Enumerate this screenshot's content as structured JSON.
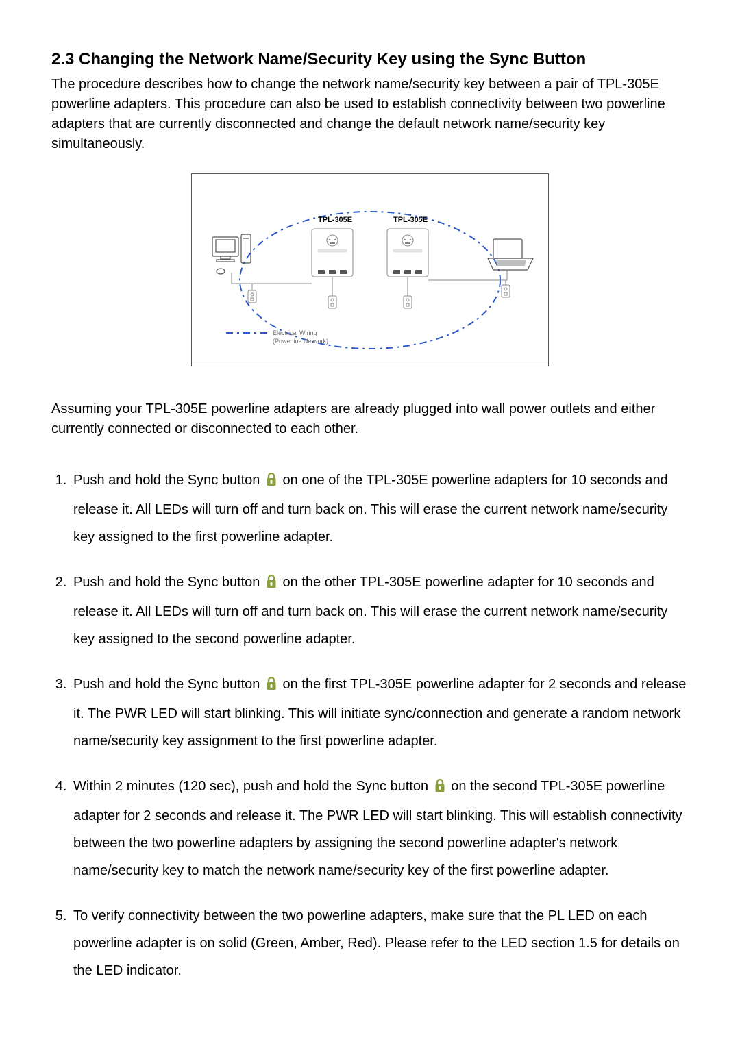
{
  "heading": "2.3  Changing the Network Name/Security Key using the Sync Button",
  "intro": "The procedure describes how to change the network name/security key between a pair of TPL-305E powerline adapters. This procedure can also be used to establish connectivity between two powerline adapters that are currently disconnected and change the default network name/security key simultaneously.",
  "assume": "Assuming your TPL-305E powerline adapters are already plugged into wall power outlets and either currently connected or disconnected to each other.",
  "diagram": {
    "device_a": "TPL-305E",
    "device_b": "TPL-305E",
    "legend_a": "Electrical Wiring",
    "legend_b": "(Powerline Network)"
  },
  "steps": {
    "s1a": "Push and hold the Sync button ",
    "s1b": " on one of the TPL-305E powerline adapters for 10 seconds and release it. All LEDs will turn off and turn back on. This will erase the current network name/security key assigned to the first powerline adapter.",
    "s2a": "Push and hold the Sync button ",
    "s2b": " on the other TPL-305E powerline adapter for 10 seconds and release it. All LEDs will turn off and turn back on. This will erase the current network name/security key assigned to the second powerline adapter.",
    "s3a": "Push and hold the Sync button ",
    "s3b": " on the first TPL-305E powerline adapter for 2 seconds and release it. The PWR LED will start blinking. This will initiate sync/connection and generate a random network name/security key assignment to the first powerline adapter.",
    "s4a": "Within 2 minutes (120 sec), push and hold the Sync button ",
    "s4b": " on the second TPL-305E powerline adapter for 2 seconds and release it. The PWR LED will start blinking. This will establish connectivity between the two powerline adapters by assigning the second powerline adapter's network name/security key to match the network name/security key of the first powerline adapter.",
    "s5": "To verify connectivity between the two powerline adapters, make sure that the PL LED on each powerline adapter is on solid (Green, Amber, Red). Please refer to the LED section 1.5 for details on the LED indicator."
  }
}
